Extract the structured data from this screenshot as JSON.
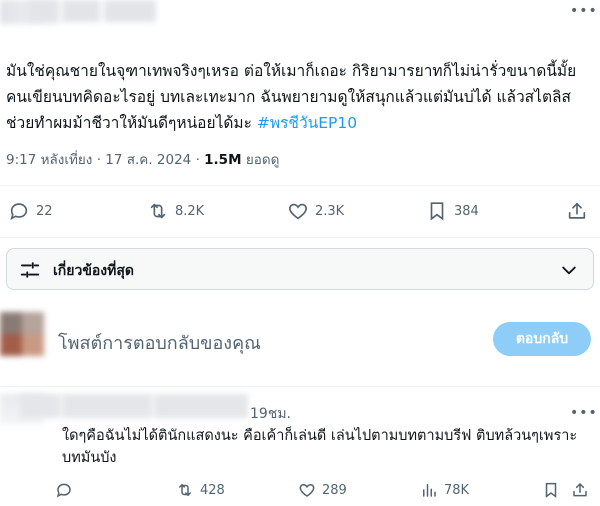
{
  "tweet": {
    "text_before_hashtag": "มันใช่คุณชายในจุฑาเทพจริงๆเหรอ ต่อให้เมาก็เถอะ กิริยามารยาทก็ไม่น่ารั่วขนาดนี้มั้ย คนเขียนบทคิดอะไรอยู่ บทเละเทะมาก ฉันพยายามดูให้สนุกแล้วแต่มันบ่ได้ แล้วสไตลิสช่วยทำผมม้าชีวาให้มันดีๆหน่อยได้มะ ",
    "hashtag": "#พรชีวันEP10",
    "time": "9:17 หลังเที่ยง",
    "date": "17 ส.ค. 2024",
    "views_count": "1.5M",
    "views_label": "ยอดดู",
    "separator": "·"
  },
  "actions": {
    "replies": "22",
    "retweets": "8.2K",
    "likes": "2.3K",
    "bookmarks": "384"
  },
  "related": {
    "label": "เกี่ยวข้องที่สุด"
  },
  "reply_box": {
    "placeholder": "โพสต์การตอบกลับของคุณ",
    "button": "ตอบกลับ"
  },
  "comment": {
    "time": "19ชม.",
    "text": "ใดๆคือฉันไม่ได้ตินักแสดงนะ คือเค้าก็เล่นดี เล่นไปตามบทตามบรีฟ ติบทล้วนๆเพราะบทมันบัง",
    "retweets": "428",
    "likes": "289",
    "views": "78K"
  },
  "colors": {
    "accent": "#1d9bf0",
    "reply_button": "#8ecdf7",
    "muted": "#536471",
    "text": "#0f1419"
  }
}
